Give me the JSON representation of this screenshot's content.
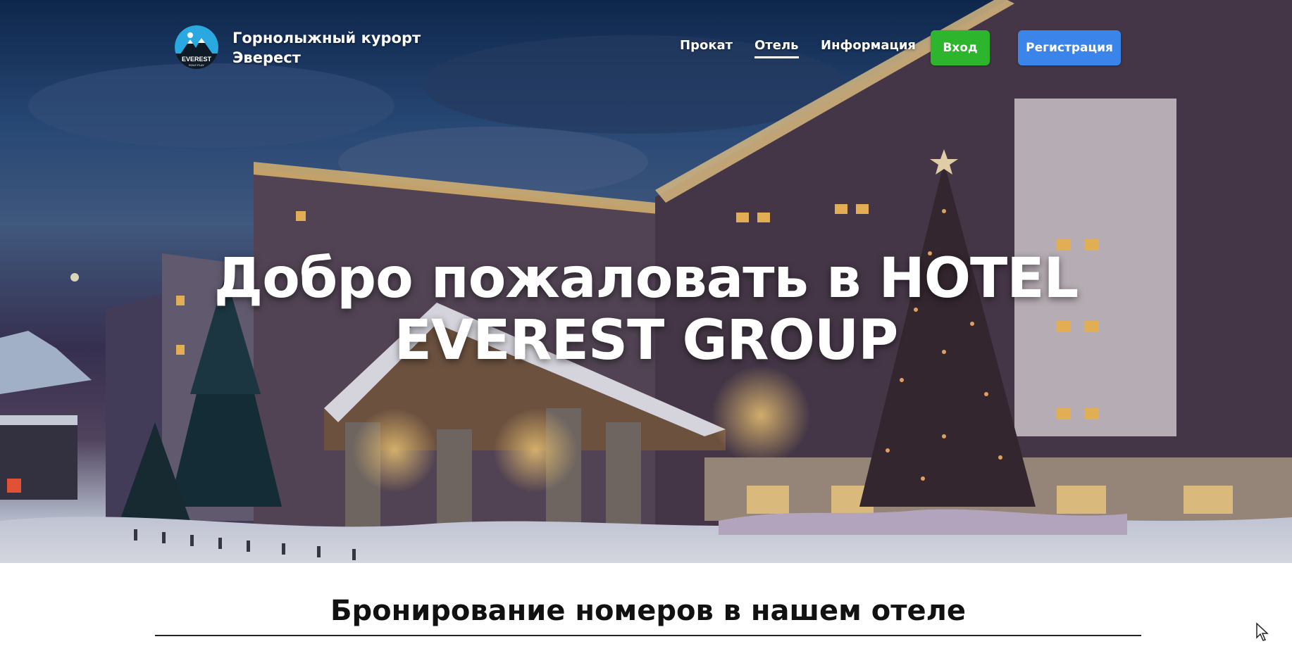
{
  "header": {
    "brand_line1": "Горнолыжный курорт",
    "brand_line2": "Эверест",
    "logo_text_main": "EVEREST",
    "logo_text_sub": "ROLE PLAY"
  },
  "nav": {
    "items": [
      {
        "label": "Прокат",
        "active": false
      },
      {
        "label": "Отель",
        "active": true
      },
      {
        "label": "Информация",
        "active": false
      }
    ],
    "login_label": "Вход",
    "register_label": "Регистрация"
  },
  "hero": {
    "title_line1": "Добро пожаловать в HOTEL",
    "title_line2": "EVEREST GROUP"
  },
  "booking": {
    "title": "Бронирование номеров в нашем отеле"
  },
  "colors": {
    "login_button": "#2db52d",
    "register_button": "#3b84ea",
    "logo_background": "#29a9df"
  }
}
